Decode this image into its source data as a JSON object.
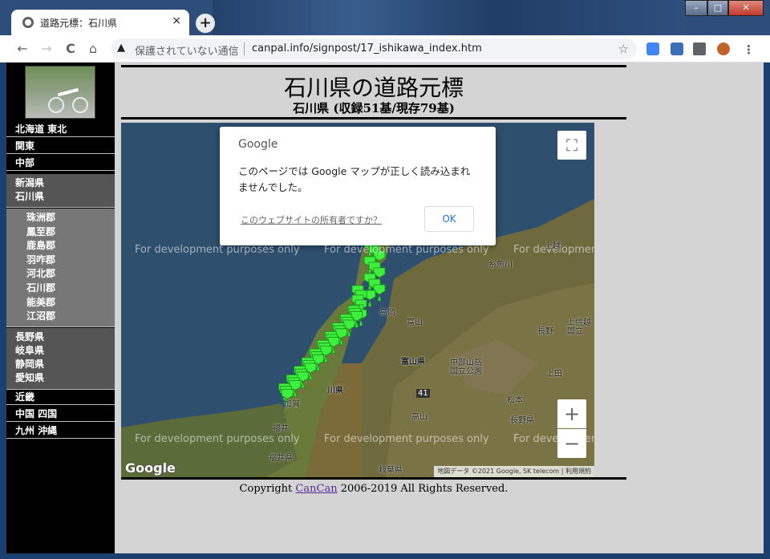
{
  "browser": {
    "tab_title": "道路元標：石川県",
    "tab_close": "×",
    "new_tab": "+",
    "window_controls": {
      "minimize": "–",
      "maximize": "□",
      "close": "✕"
    },
    "nav": {
      "back": "←",
      "forward": "→",
      "reload": "C",
      "home": "⌂"
    },
    "security_icon": "▲",
    "security_text": "保護されていない通信",
    "url": "canpal.info/signpost/17_ishikawa_index.htm",
    "star": "☆",
    "menu": "⋮"
  },
  "sidebar": {
    "items_top": [
      "北海道 東北",
      "関東",
      "中部"
    ],
    "group1": [
      "新潟県",
      "石川県"
    ],
    "districts": [
      "珠洲郡",
      "鳳至郡",
      "鹿島郡",
      "羽咋郡",
      "河北郡",
      "石川郡",
      "能美郡",
      "江沼郡"
    ],
    "group2": [
      "長野県",
      "岐阜県",
      "静岡県",
      "愛知県"
    ],
    "items_bottom": [
      "近畿",
      "中国 四国",
      "九州 沖縄"
    ]
  },
  "content": {
    "title": "石川県の道路元標",
    "subtitle": "石川県 (収録51基/現存79基)",
    "copyright_prefix": "Copyright ",
    "copyright_link": "CanCan",
    "copyright_suffix": " 2006-2019 All Rights Reserved."
  },
  "map": {
    "dialog": {
      "brand": "Google",
      "message": "このページでは Google マップが正しく読み込まれませんでした。",
      "owner_link": "このウェブサイトの所有者ですか？",
      "ok": "OK"
    },
    "dev_watermark": "For development purposes only",
    "labels": {
      "itoigawa": "糸魚川",
      "takaoka": "高岡",
      "toyama": "富山",
      "toyama_pref": "富山県",
      "chubu_park": "中部山岳\n国立公園",
      "nagano": "長野",
      "joshinetsu": "上信越\n国立",
      "ueda": "上田",
      "matsumoto": "松本",
      "nagano_pref": "長野県",
      "takayama": "高山",
      "route41": "41",
      "kaga": "加賀",
      "fukui": "福井",
      "fukui_pref": "福井県",
      "gifu_pref": "岐阜県",
      "joetsu": "上越",
      "ishikawa_pref": "川県"
    },
    "google_logo": "Google",
    "attribution": "地図データ ©2021 Google, SK telecom | 利用規約",
    "fullscreen": "⛶",
    "zoom_in": "+",
    "zoom_out": "−"
  }
}
